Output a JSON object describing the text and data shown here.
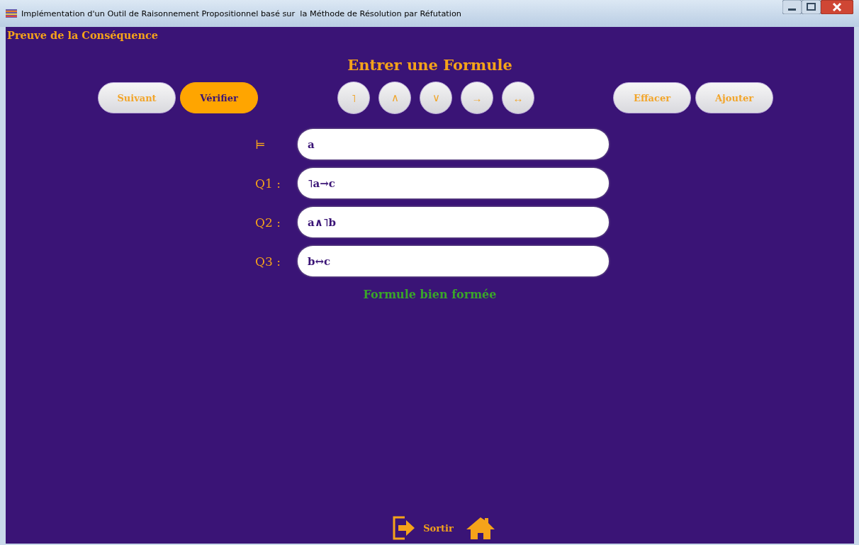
{
  "window": {
    "title": "Implémentation d'un Outil de Raisonnement Propositionnel basé sur  la Méthode de Résolution par Réfutation"
  },
  "page_title": "Preuve de la Conséquence",
  "heading": "Entrer une Formule",
  "nav_buttons": [
    {
      "label": "Suivant",
      "selected": false
    },
    {
      "label": "Vérifier",
      "selected": true
    }
  ],
  "operators": [
    "˥",
    "∧",
    "∨",
    "→",
    "↔"
  ],
  "edit_buttons": [
    "Effacer",
    "Ajouter"
  ],
  "formulas": [
    {
      "label": "⊨",
      "value": "a"
    },
    {
      "label": "Q1 :",
      "value": "˥a→c"
    },
    {
      "label": "Q2 :",
      "value": "a∧˥b"
    },
    {
      "label": "Q3 :",
      "value": "b↔c"
    }
  ],
  "status": {
    "text": "Formule bien formée",
    "kind": "valid"
  },
  "footer": {
    "exit_label": "Sortir"
  }
}
